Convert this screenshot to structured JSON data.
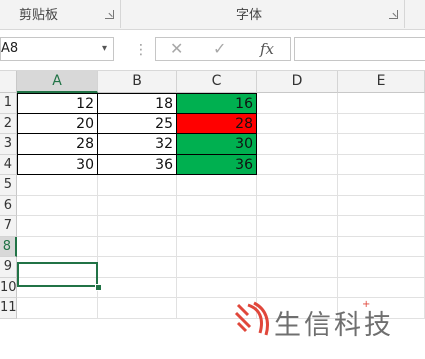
{
  "ribbon": {
    "clipboard_label": "剪贴板",
    "font_label": "字体"
  },
  "formula_bar": {
    "name_box": "A8",
    "name_caret": "▾",
    "dots": "⋮",
    "cancel_symbol": "✕",
    "confirm_symbol": "✓",
    "fx_symbol": "fx",
    "formula_value": ""
  },
  "sheet": {
    "columns": [
      "A",
      "B",
      "C",
      "D",
      "E"
    ],
    "rows": [
      "1",
      "2",
      "3",
      "4",
      "5",
      "6",
      "7",
      "8",
      "9",
      "10",
      "11"
    ],
    "selected_cell": "A8",
    "data": [
      [
        12,
        18,
        16
      ],
      [
        20,
        25,
        28
      ],
      [
        28,
        32,
        30
      ],
      [
        30,
        36,
        36
      ]
    ],
    "fill_colors": {
      "green": "#00b050",
      "red": "#ff0000"
    },
    "column_c_fill": [
      "green",
      "red",
      "green",
      "green"
    ]
  },
  "watermark": {
    "text": "生信科技",
    "logo_color": "#e0473b",
    "star": "+"
  }
}
